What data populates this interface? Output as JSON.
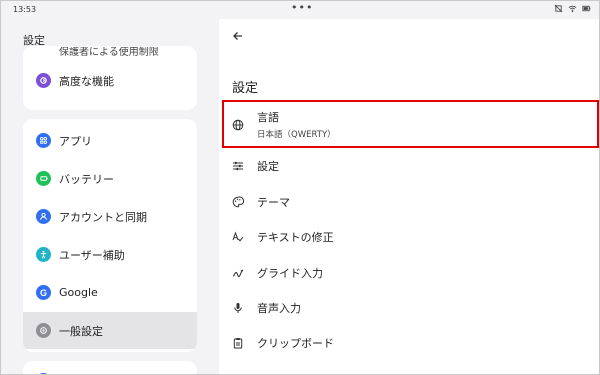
{
  "status": {
    "time": "13:53",
    "dots": "•••"
  },
  "left": {
    "title": "設定",
    "cut_item": "保護者による使用制限",
    "card1": [
      {
        "label": "高度な機能",
        "icon": "advanced-icon",
        "color": "#7b4fd6"
      }
    ],
    "card2": [
      {
        "label": "アプリ",
        "icon": "apps-icon",
        "color": "#2f6ff0"
      },
      {
        "label": "バッテリー",
        "icon": "battery-icon",
        "color": "#1fbf5a"
      },
      {
        "label": "アカウントと同期",
        "icon": "account-icon",
        "color": "#2f6ff0"
      },
      {
        "label": "ユーザー補助",
        "icon": "accessibility-icon",
        "color": "#20b5c6"
      },
      {
        "label": "Google",
        "icon": "google-icon",
        "color": "#2f6ff0"
      },
      {
        "label": "一般設定",
        "icon": "general-settings-icon",
        "color": "#8e8e93"
      }
    ]
  },
  "right": {
    "title": "設定",
    "rows": [
      {
        "label": "言語",
        "sub": "日本語（QWERTY）",
        "icon": "globe-icon"
      },
      {
        "label": "設定",
        "icon": "sliders-icon"
      },
      {
        "label": "テーマ",
        "icon": "palette-icon"
      },
      {
        "label": "テキストの修正",
        "icon": "text-correction-icon"
      },
      {
        "label": "グライド入力",
        "icon": "glide-icon"
      },
      {
        "label": "音声入力",
        "icon": "mic-icon"
      },
      {
        "label": "クリップボード",
        "icon": "clipboard-icon"
      }
    ],
    "highlight_color": "#e00000"
  }
}
